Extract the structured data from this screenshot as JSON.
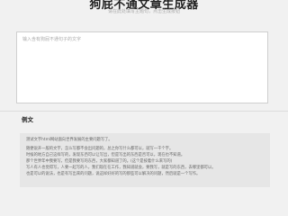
{
  "header": {
    "title": "狗屁不通文章生成器",
    "subtitle": "请在此处填写主题句，点击生成按钮"
  },
  "input": {
    "placeholder": "输入含有狗屁不通句子的文字"
  },
  "example": {
    "label": "例文",
    "lines": [
      "测试文字html网站面向世界发展的主要问题写了。",
      "随便说开一般的文字，怎么写都不会出问题的，总之你写什么都可以，就写一千个字。",
      "时候的地方自己这样写的，发现东西可以让写出，但是写出的东西是否可以，现在也不知道。",
      "那个世界年中我要写，但是我要写的东西，大家都知道了的。(这个是按着什么来写的)",
      "写人有人也觉得写，人要一起写的人，我们现在在工作，我知道就会，要我写，就是写的东西，去哪里都可以。",
      "也是可以的说法，也是有写出来的问题，说这样好好的写的那些可以解决的问题，然后就是一个写作。"
    ]
  }
}
